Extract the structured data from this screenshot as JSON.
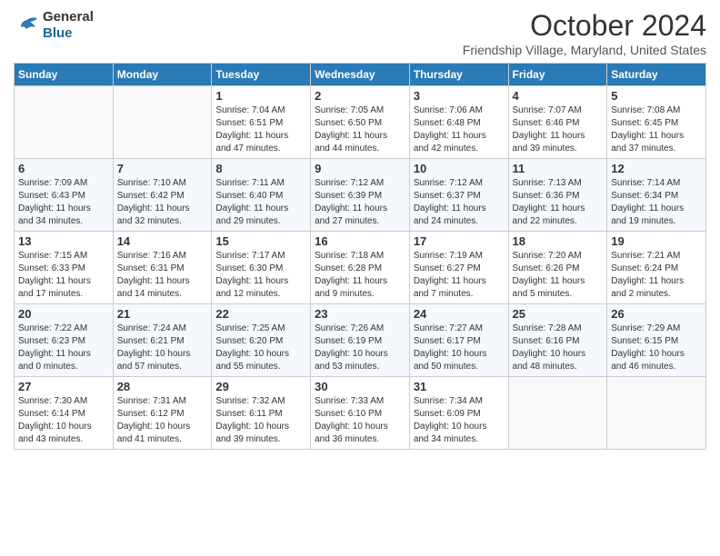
{
  "header": {
    "logo_general": "General",
    "logo_blue": "Blue",
    "month_title": "October 2024",
    "location": "Friendship Village, Maryland, United States"
  },
  "days_of_week": [
    "Sunday",
    "Monday",
    "Tuesday",
    "Wednesday",
    "Thursday",
    "Friday",
    "Saturday"
  ],
  "weeks": [
    [
      {
        "day": "",
        "info": ""
      },
      {
        "day": "",
        "info": ""
      },
      {
        "day": "1",
        "info": "Sunrise: 7:04 AM\nSunset: 6:51 PM\nDaylight: 11 hours\nand 47 minutes."
      },
      {
        "day": "2",
        "info": "Sunrise: 7:05 AM\nSunset: 6:50 PM\nDaylight: 11 hours\nand 44 minutes."
      },
      {
        "day": "3",
        "info": "Sunrise: 7:06 AM\nSunset: 6:48 PM\nDaylight: 11 hours\nand 42 minutes."
      },
      {
        "day": "4",
        "info": "Sunrise: 7:07 AM\nSunset: 6:46 PM\nDaylight: 11 hours\nand 39 minutes."
      },
      {
        "day": "5",
        "info": "Sunrise: 7:08 AM\nSunset: 6:45 PM\nDaylight: 11 hours\nand 37 minutes."
      }
    ],
    [
      {
        "day": "6",
        "info": "Sunrise: 7:09 AM\nSunset: 6:43 PM\nDaylight: 11 hours\nand 34 minutes."
      },
      {
        "day": "7",
        "info": "Sunrise: 7:10 AM\nSunset: 6:42 PM\nDaylight: 11 hours\nand 32 minutes."
      },
      {
        "day": "8",
        "info": "Sunrise: 7:11 AM\nSunset: 6:40 PM\nDaylight: 11 hours\nand 29 minutes."
      },
      {
        "day": "9",
        "info": "Sunrise: 7:12 AM\nSunset: 6:39 PM\nDaylight: 11 hours\nand 27 minutes."
      },
      {
        "day": "10",
        "info": "Sunrise: 7:12 AM\nSunset: 6:37 PM\nDaylight: 11 hours\nand 24 minutes."
      },
      {
        "day": "11",
        "info": "Sunrise: 7:13 AM\nSunset: 6:36 PM\nDaylight: 11 hours\nand 22 minutes."
      },
      {
        "day": "12",
        "info": "Sunrise: 7:14 AM\nSunset: 6:34 PM\nDaylight: 11 hours\nand 19 minutes."
      }
    ],
    [
      {
        "day": "13",
        "info": "Sunrise: 7:15 AM\nSunset: 6:33 PM\nDaylight: 11 hours\nand 17 minutes."
      },
      {
        "day": "14",
        "info": "Sunrise: 7:16 AM\nSunset: 6:31 PM\nDaylight: 11 hours\nand 14 minutes."
      },
      {
        "day": "15",
        "info": "Sunrise: 7:17 AM\nSunset: 6:30 PM\nDaylight: 11 hours\nand 12 minutes."
      },
      {
        "day": "16",
        "info": "Sunrise: 7:18 AM\nSunset: 6:28 PM\nDaylight: 11 hours\nand 9 minutes."
      },
      {
        "day": "17",
        "info": "Sunrise: 7:19 AM\nSunset: 6:27 PM\nDaylight: 11 hours\nand 7 minutes."
      },
      {
        "day": "18",
        "info": "Sunrise: 7:20 AM\nSunset: 6:26 PM\nDaylight: 11 hours\nand 5 minutes."
      },
      {
        "day": "19",
        "info": "Sunrise: 7:21 AM\nSunset: 6:24 PM\nDaylight: 11 hours\nand 2 minutes."
      }
    ],
    [
      {
        "day": "20",
        "info": "Sunrise: 7:22 AM\nSunset: 6:23 PM\nDaylight: 11 hours\nand 0 minutes."
      },
      {
        "day": "21",
        "info": "Sunrise: 7:24 AM\nSunset: 6:21 PM\nDaylight: 10 hours\nand 57 minutes."
      },
      {
        "day": "22",
        "info": "Sunrise: 7:25 AM\nSunset: 6:20 PM\nDaylight: 10 hours\nand 55 minutes."
      },
      {
        "day": "23",
        "info": "Sunrise: 7:26 AM\nSunset: 6:19 PM\nDaylight: 10 hours\nand 53 minutes."
      },
      {
        "day": "24",
        "info": "Sunrise: 7:27 AM\nSunset: 6:17 PM\nDaylight: 10 hours\nand 50 minutes."
      },
      {
        "day": "25",
        "info": "Sunrise: 7:28 AM\nSunset: 6:16 PM\nDaylight: 10 hours\nand 48 minutes."
      },
      {
        "day": "26",
        "info": "Sunrise: 7:29 AM\nSunset: 6:15 PM\nDaylight: 10 hours\nand 46 minutes."
      }
    ],
    [
      {
        "day": "27",
        "info": "Sunrise: 7:30 AM\nSunset: 6:14 PM\nDaylight: 10 hours\nand 43 minutes."
      },
      {
        "day": "28",
        "info": "Sunrise: 7:31 AM\nSunset: 6:12 PM\nDaylight: 10 hours\nand 41 minutes."
      },
      {
        "day": "29",
        "info": "Sunrise: 7:32 AM\nSunset: 6:11 PM\nDaylight: 10 hours\nand 39 minutes."
      },
      {
        "day": "30",
        "info": "Sunrise: 7:33 AM\nSunset: 6:10 PM\nDaylight: 10 hours\nand 36 minutes."
      },
      {
        "day": "31",
        "info": "Sunrise: 7:34 AM\nSunset: 6:09 PM\nDaylight: 10 hours\nand 34 minutes."
      },
      {
        "day": "",
        "info": ""
      },
      {
        "day": "",
        "info": ""
      }
    ]
  ]
}
